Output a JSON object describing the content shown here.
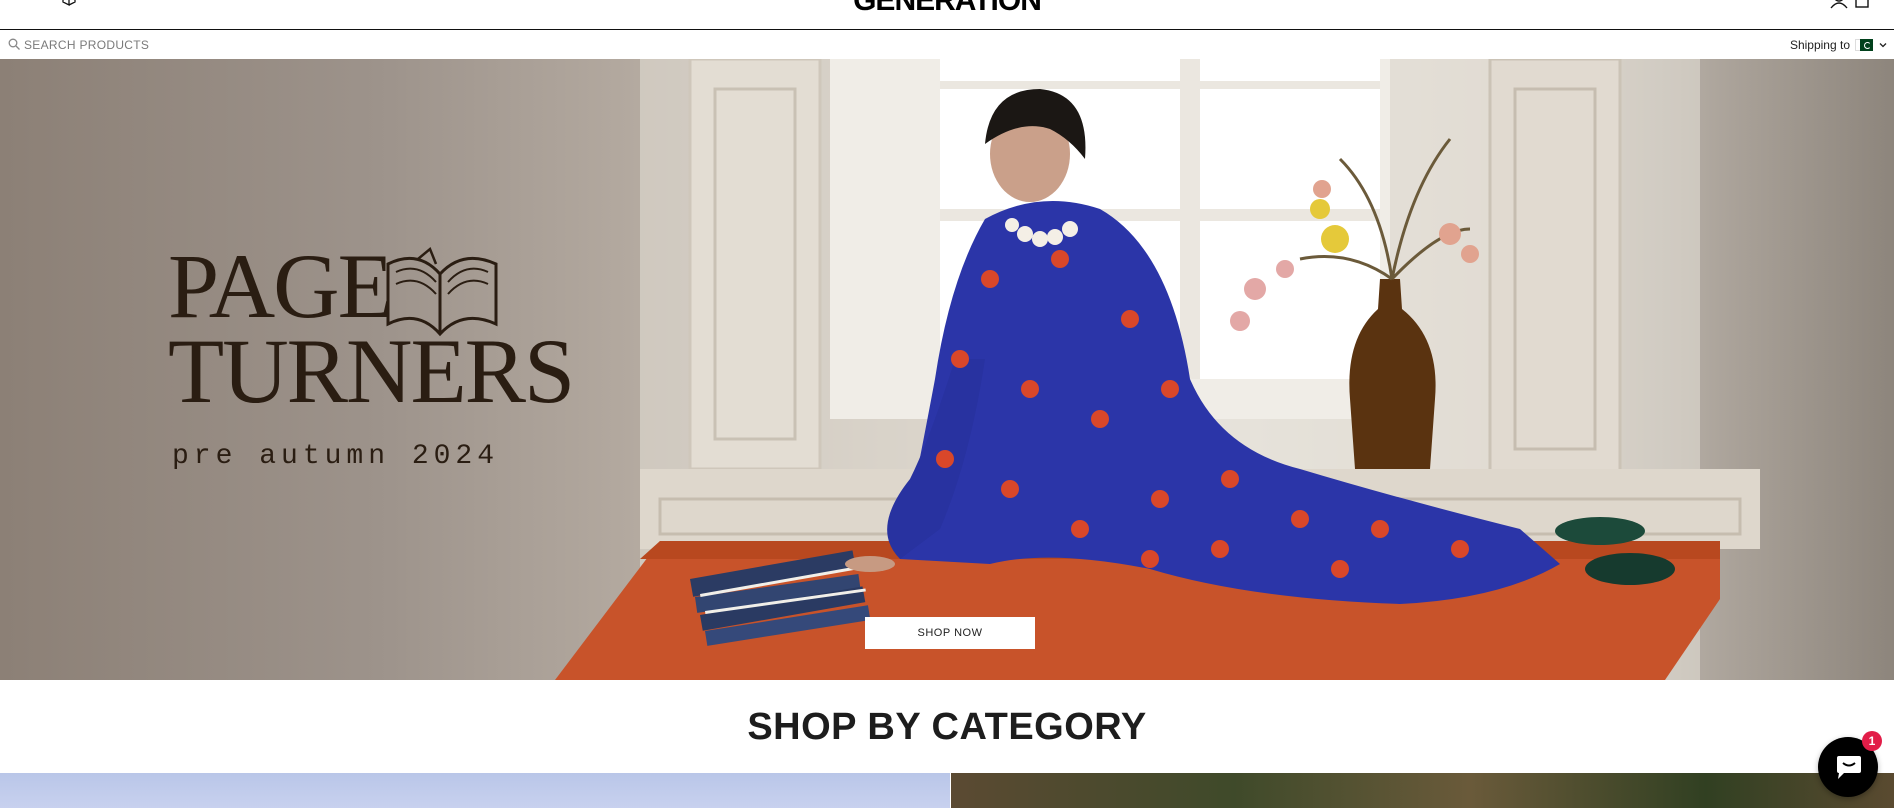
{
  "header": {
    "logo": "GENERATION",
    "icons": [
      "menu-icon",
      "cube-icon",
      "account-icon",
      "cart-icon"
    ]
  },
  "search": {
    "placeholder": "SEARCH PRODUCTS",
    "shipping_label": "Shipping to"
  },
  "hero": {
    "title_line1": "PAGE",
    "title_line2": "TURNERS",
    "subtitle": "pre autumn 2024",
    "cta": "SHOP NOW"
  },
  "categories": {
    "title": "SHOP BY CATEGORY"
  },
  "chat": {
    "badge": "1"
  },
  "colors": {
    "accent": "#000000",
    "title_text": "#2a1d12",
    "badge": "#e21d48",
    "outfit_blue": "#2b35a8",
    "table_orange": "#c8532a"
  }
}
